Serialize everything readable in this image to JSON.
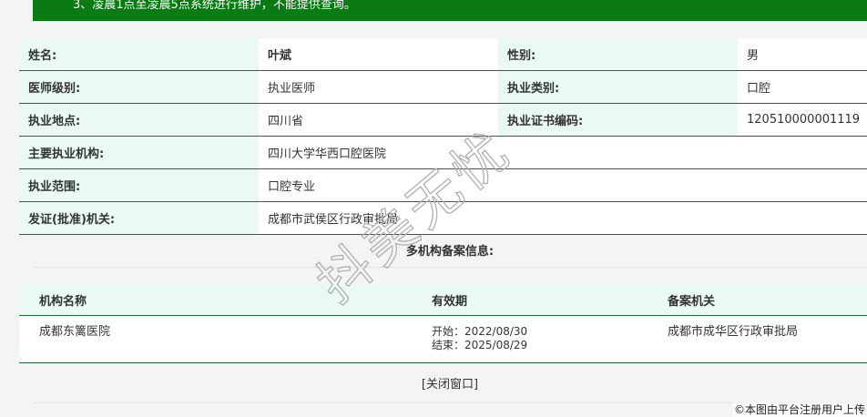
{
  "notice": {
    "text": "3、凌晨1点至凌晨5点系统进行维护，不能提供查询。"
  },
  "info": {
    "name_label": "姓名:",
    "name_value": "叶斌",
    "gender_label": "性别:",
    "gender_value": "男",
    "level_label": "医师级别:",
    "level_value": "执业医师",
    "category_label": "执业类别:",
    "category_value": "口腔",
    "location_label": "执业地点:",
    "location_value": "四川省",
    "cert_label": "执业证书编码:",
    "cert_value": "120510000001119",
    "org_label": "主要执业机构:",
    "org_value": "四川大学华西口腔医院",
    "scope_label": "执业范围:",
    "scope_value": "口腔专业",
    "issuer_label": "发证(批准)机关:",
    "issuer_value": "成都市武侯区行政审批局"
  },
  "records": {
    "title": "多机构备案信息:",
    "headers": {
      "org": "机构名称",
      "period": "有效期",
      "authority": "备案机关"
    },
    "rows": [
      {
        "org": "成都东篱医院",
        "start": "开始：2022/08/30",
        "end": "结束：2025/08/29",
        "authority": "成都市成华区行政审批局"
      }
    ]
  },
  "close_label": "[关闭窗口]",
  "watermark_text": "抖美无忧",
  "credit": "©本图由平台注册用户上传",
  "colors": {
    "notice_bg": "#0a7a12",
    "label_bg": "#eafaf2",
    "border": "#1e6b3c"
  }
}
